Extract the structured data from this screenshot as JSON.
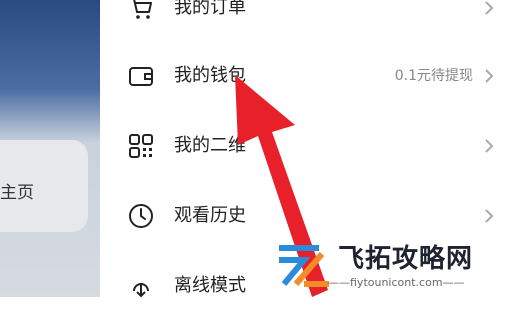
{
  "left": {
    "home_label": "主页"
  },
  "menu": {
    "items": [
      {
        "label": "我的订单",
        "value": "",
        "icon": "cart-icon"
      },
      {
        "label": "我的钱包",
        "value": "0.1元待提现",
        "icon": "wallet-icon"
      },
      {
        "label": "我的二维",
        "value": "",
        "icon": "qr-code-icon"
      },
      {
        "label": "观看历史",
        "value": "",
        "icon": "clock-icon"
      },
      {
        "label": "离线模式",
        "value": "",
        "icon": "download-icon"
      }
    ]
  },
  "watermark": {
    "title": "飞拓攻略网",
    "url": "——fiytounicont.com——"
  },
  "colors": {
    "arrow": "#e8202a",
    "logo_blue": "#2b8bd8",
    "logo_orange": "#f28c28"
  }
}
